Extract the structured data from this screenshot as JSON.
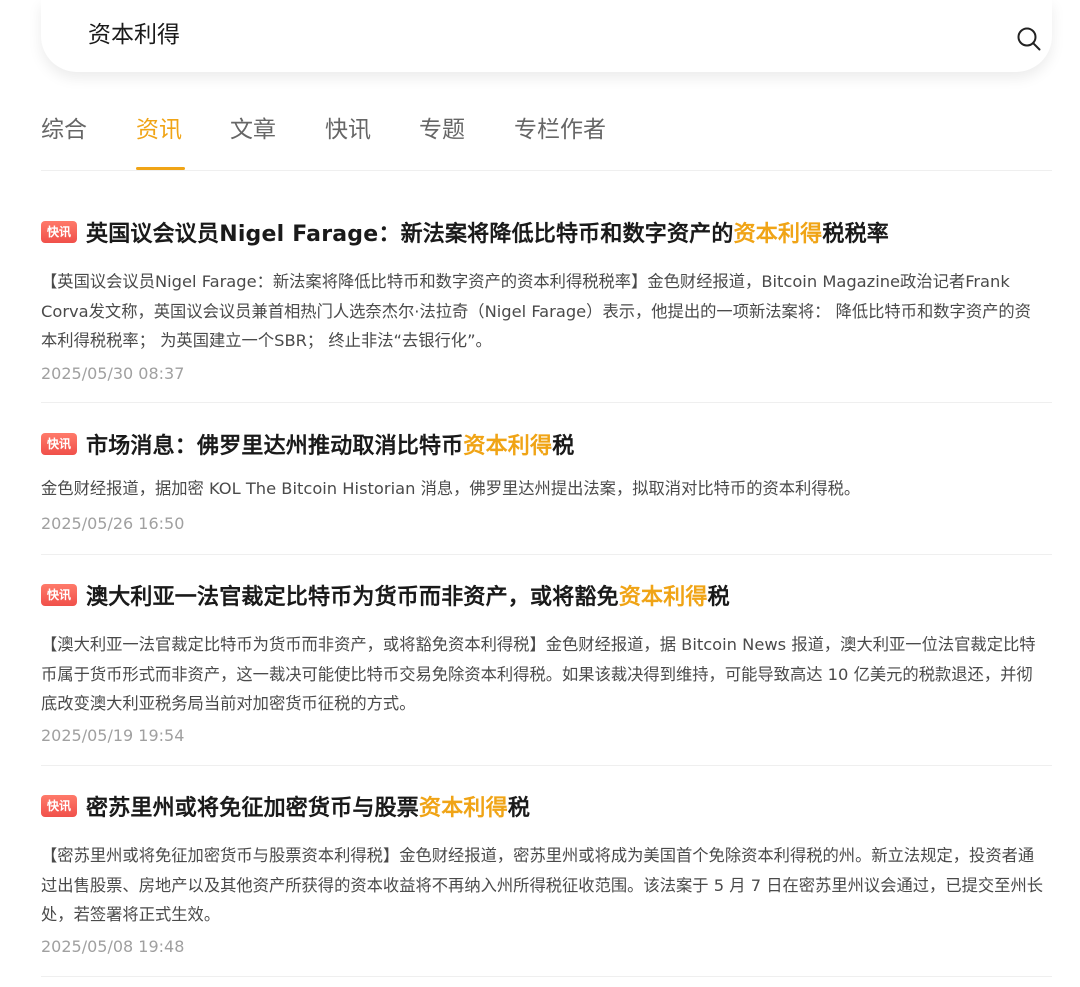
{
  "search": {
    "query": "资本利得"
  },
  "tabs": [
    {
      "label": "综合"
    },
    {
      "label": "资讯"
    },
    {
      "label": "文章"
    },
    {
      "label": "快讯"
    },
    {
      "label": "专题"
    },
    {
      "label": "专栏作者"
    }
  ],
  "active_tab": "资讯",
  "colors": {
    "accent": "#f0a416",
    "badge": "#f0504a",
    "text_primary": "#1a1a1a",
    "text_secondary": "#4a4a4a",
    "text_muted": "#a0a0a0"
  },
  "news": [
    {
      "badge": "快讯",
      "title_pre": "英国议会议员Nigel Farage：新法案将降低比特币和数字资产的",
      "title_hl": "资本利得",
      "title_post": "税税率",
      "summary": "【英国议会议员Nigel Farage：新法案将降低比特币和数字资产的资本利得税税率】金色财经报道，Bitcoin Magazine政治记者Frank Corva发文称，英国议会议员兼首相热门人选奈杰尔·法拉奇（Nigel Farage）表示，他提出的一项新法案将： 降低比特币和数字资产的资本利得税税率； 为英国建立一个SBR； 终止非法“去银行化”。",
      "time": "2025/05/30 08:37"
    },
    {
      "badge": "快讯",
      "title_pre": "市场消息：佛罗里达州推动取消比特币",
      "title_hl": "资本利得",
      "title_post": "税",
      "summary": "金色财经报道，据加密 KOL The Bitcoin Historian 消息，佛罗里达州提出法案，拟取消对比特币的资本利得税。",
      "time": "2025/05/26 16:50"
    },
    {
      "badge": "快讯",
      "title_pre": "澳大利亚一法官裁定比特币为货币而非资产，或将豁免",
      "title_hl": "资本利得",
      "title_post": "税",
      "summary": "【澳大利亚一法官裁定比特币为货币而非资产，或将豁免资本利得税】金色财经报道，据 Bitcoin News 报道，澳大利亚一位法官裁定比特币属于货币形式而非资产，这一裁决可能使比特币交易免除资本利得税。如果该裁决得到维持，可能导致高达 10 亿美元的税款退还，并彻底改变澳大利亚税务局当前对加密货币征税的方式。",
      "time": "2025/05/19 19:54"
    },
    {
      "badge": "快讯",
      "title_pre": "密苏里州或将免征加密货币与股票",
      "title_hl": "资本利得",
      "title_post": "税",
      "summary": "【密苏里州或将免征加密货币与股票资本利得税】金色财经报道，密苏里州或将成为美国首个免除资本利得税的州。新立法规定，投资者通过出售股票、房地产以及其他资产所获得的资本收益将不再纳入州所得税征收范围。该法案于 5 月 7 日在密苏里州议会通过，已提交至州长处，若签署将正式生效。",
      "time": "2025/05/08 19:48"
    }
  ]
}
